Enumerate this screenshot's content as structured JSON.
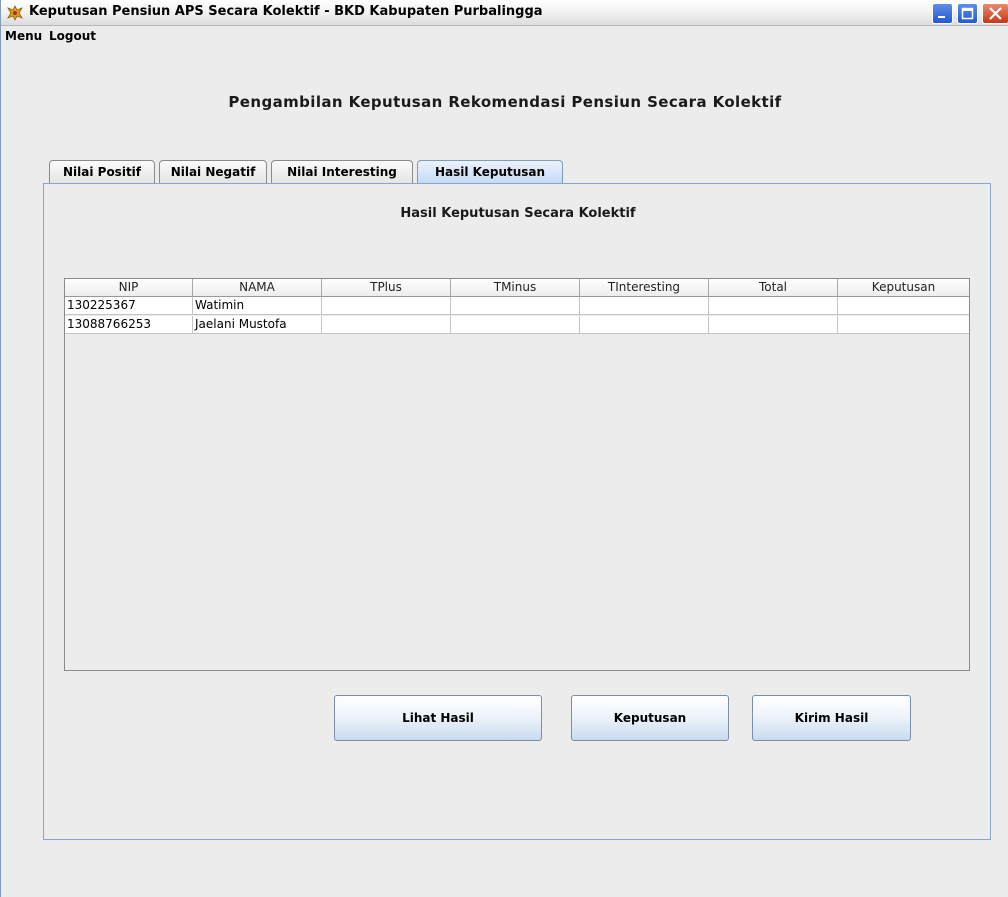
{
  "window": {
    "title": "Keputusan Pensiun APS Secara Kolektif - BKD Kabupaten Purbalingga"
  },
  "menubar": {
    "items": [
      {
        "label": "Menu"
      },
      {
        "label": "Logout"
      }
    ]
  },
  "page_title": "Pengambilan Keputusan Rekomendasi Pensiun Secara Kolektif",
  "tabs": [
    {
      "label": "Nilai Positif",
      "selected": false
    },
    {
      "label": "Nilai Negatif",
      "selected": false
    },
    {
      "label": "Nilai Interesting",
      "selected": false
    },
    {
      "label": "Hasil Keputusan",
      "selected": true
    }
  ],
  "panel": {
    "heading": "Hasil Keputusan Secara Kolektif"
  },
  "table": {
    "columns": [
      "NIP",
      "NAMA",
      "TPlus",
      "TMinus",
      "TInteresting",
      "Total",
      "Keputusan"
    ],
    "rows": [
      [
        "130225367",
        "Watimin",
        "",
        "",
        "",
        "",
        ""
      ],
      [
        "13088766253",
        "Jaelani Mustofa",
        "",
        "",
        "",
        "",
        ""
      ]
    ]
  },
  "buttons": {
    "lihat_hasil": "Lihat Hasil",
    "keputusan": "Keputusan",
    "kirim_hasil": "Kirim Hasil"
  },
  "icons": {
    "app_icon": "garuda-emblem-icon",
    "minimize": "minimize-icon",
    "maximize": "maximize-icon",
    "close": "close-icon"
  }
}
